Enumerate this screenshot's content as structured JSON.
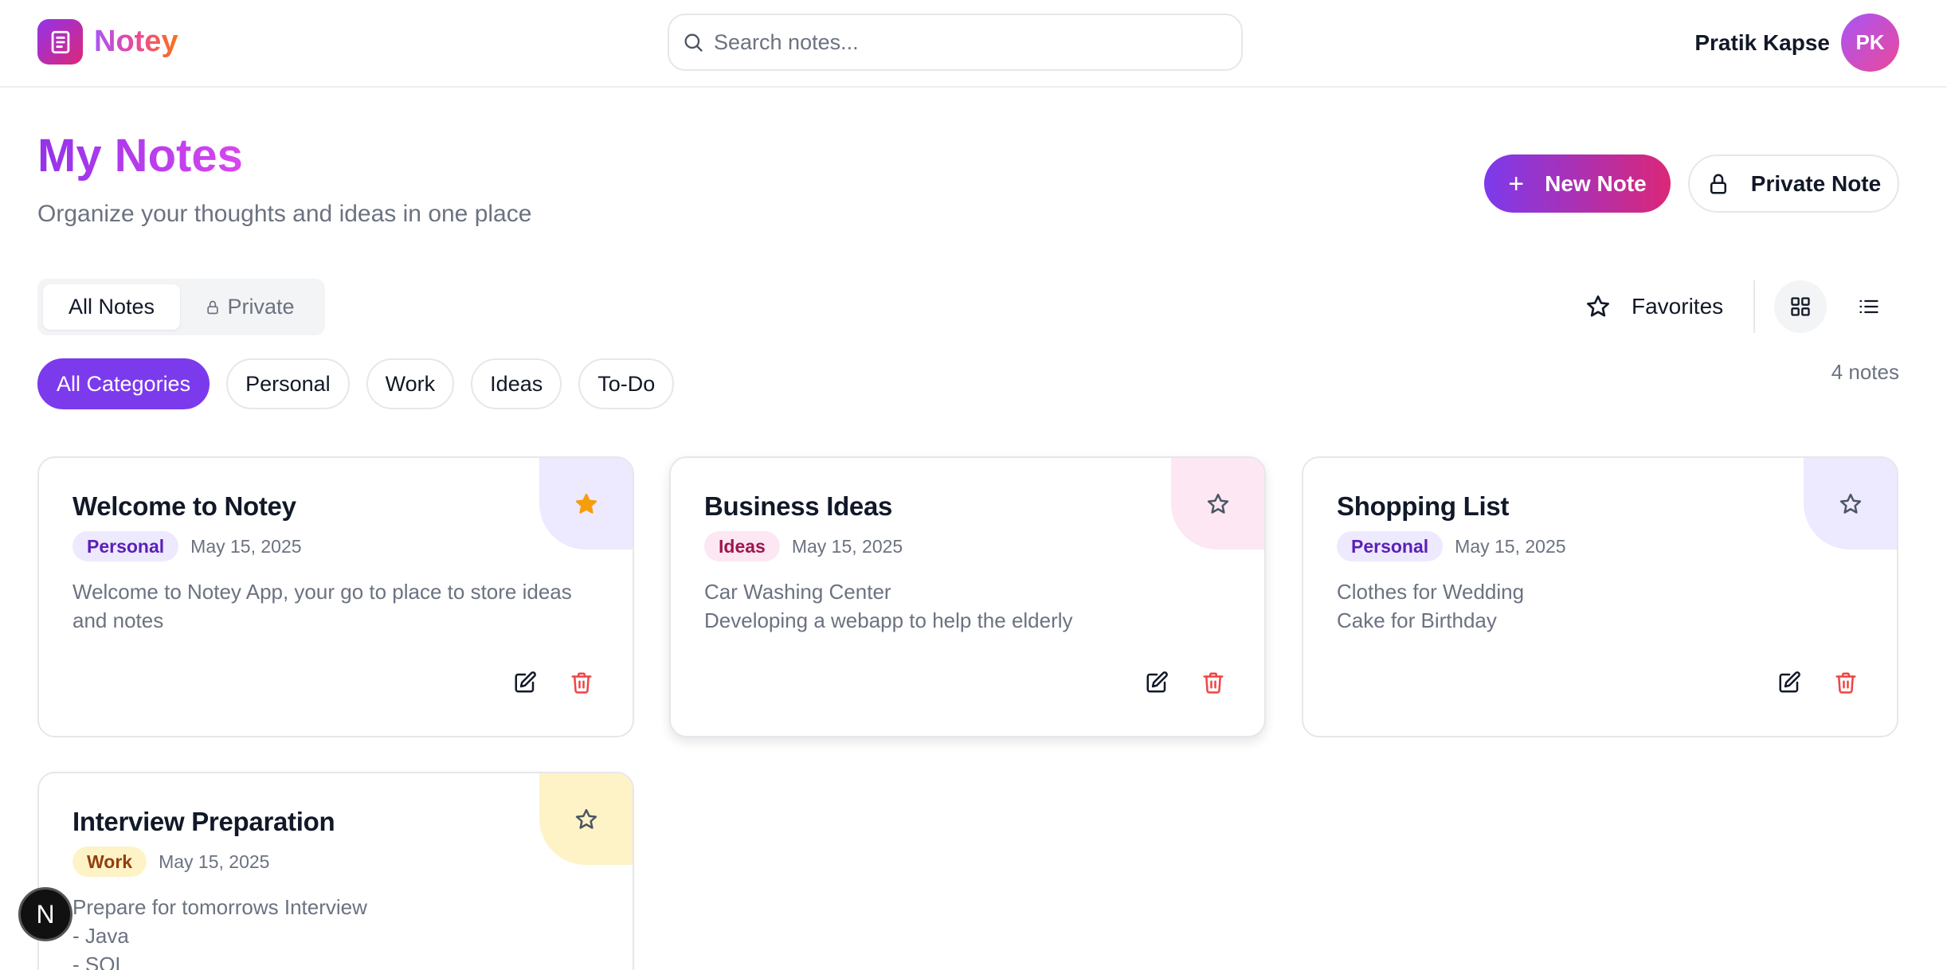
{
  "app": {
    "name": "Notey"
  },
  "search": {
    "placeholder": "Search notes..."
  },
  "user": {
    "name": "Pratik Kapse",
    "initials": "PK"
  },
  "page": {
    "title": "My Notes",
    "subtitle": "Organize your thoughts and ideas in one place"
  },
  "actions": {
    "new_note": "New Note",
    "private_note": "Private Note"
  },
  "tabs": [
    {
      "label": "All Notes",
      "active": true
    },
    {
      "label": "Private",
      "active": false
    }
  ],
  "favorites_label": "Favorites",
  "view_modes": [
    {
      "name": "grid",
      "active": true
    },
    {
      "name": "list",
      "active": false
    }
  ],
  "categories": [
    {
      "label": "All Categories",
      "active": true
    },
    {
      "label": "Personal",
      "active": false
    },
    {
      "label": "Work",
      "active": false
    },
    {
      "label": "Ideas",
      "active": false
    },
    {
      "label": "To-Do",
      "active": false
    }
  ],
  "notes_count": "4 notes",
  "notes": [
    {
      "title": "Welcome to Notey",
      "tag": "Personal",
      "date": "May 15, 2025",
      "body": [
        "Welcome to Notey App, your go to place to store ideas",
        "and notes"
      ],
      "favorite": true,
      "accent": "#ede9fe",
      "tag_bg": "#ede9fe",
      "tag_color": "#5b21b6"
    },
    {
      "title": "Business Ideas",
      "tag": "Ideas",
      "date": "May 15, 2025",
      "body": [
        "Car Washing Center",
        "Developing a webapp to help the elderly"
      ],
      "favorite": false,
      "accent": "#fce7f3",
      "tag_bg": "#fce7f3",
      "tag_color": "#9d174d"
    },
    {
      "title": "Shopping List",
      "tag": "Personal",
      "date": "May 15, 2025",
      "body": [
        "Clothes for Wedding",
        "Cake for Birthday"
      ],
      "favorite": false,
      "accent": "#ede9fe",
      "tag_bg": "#ede9fe",
      "tag_color": "#5b21b6"
    },
    {
      "title": "Interview Preparation",
      "tag": "Work",
      "date": "May 15, 2025",
      "body": [
        "Prepare for tomorrows Interview",
        "- Java",
        "- SQL"
      ],
      "favorite": false,
      "accent": "#fef3c7",
      "tag_bg": "#fef3c7",
      "tag_color": "#92400e"
    }
  ],
  "fab": {
    "label": "N"
  },
  "colors": {
    "brand": "#7c3aed",
    "brand_pink": "#db2777",
    "star_active": "#f59e0b",
    "delete": "#ef4444"
  }
}
